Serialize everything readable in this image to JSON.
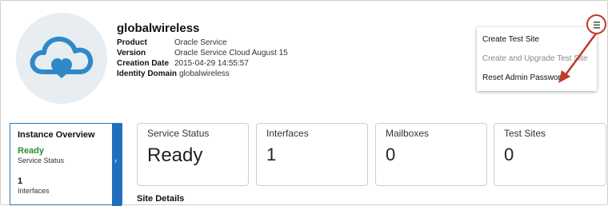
{
  "service": {
    "name": "globalwireless",
    "details": [
      {
        "label": "Product",
        "value": "Oracle Service"
      },
      {
        "label": "Version",
        "value": "Oracle Service Cloud August 15"
      },
      {
        "label": "Creation Date",
        "value": "2015-04-29 14:55:57"
      },
      {
        "label": "Identity Domain",
        "value": "globalwireless"
      }
    ]
  },
  "menu": {
    "items": [
      {
        "label": "Create Test Site",
        "enabled": true
      },
      {
        "label": "Create and Upgrade Test Site",
        "enabled": false
      },
      {
        "label": "Reset Admin Password",
        "enabled": true
      }
    ]
  },
  "overview": {
    "title": "Instance Overview",
    "status_value": "Ready",
    "status_label": "Service Status",
    "count_value": "1",
    "count_label": "Interfaces",
    "expand_glyph": "›"
  },
  "cards": [
    {
      "label": "Service Status",
      "value": "Ready"
    },
    {
      "label": "Interfaces",
      "value": "1"
    },
    {
      "label": "Mailboxes",
      "value": "0"
    },
    {
      "label": "Test Sites",
      "value": "0"
    }
  ],
  "site_details_heading": "Site Details",
  "colors": {
    "accent_blue": "#2e75b6",
    "ready_green": "#2e8b2e",
    "callout_red": "#c0392b",
    "cloud_blue": "#2f89c8"
  },
  "icons": {
    "logo": "cloud-heart-icon",
    "menu": "hamburger-menu-icon",
    "callout": "red-arrow-annotation"
  }
}
